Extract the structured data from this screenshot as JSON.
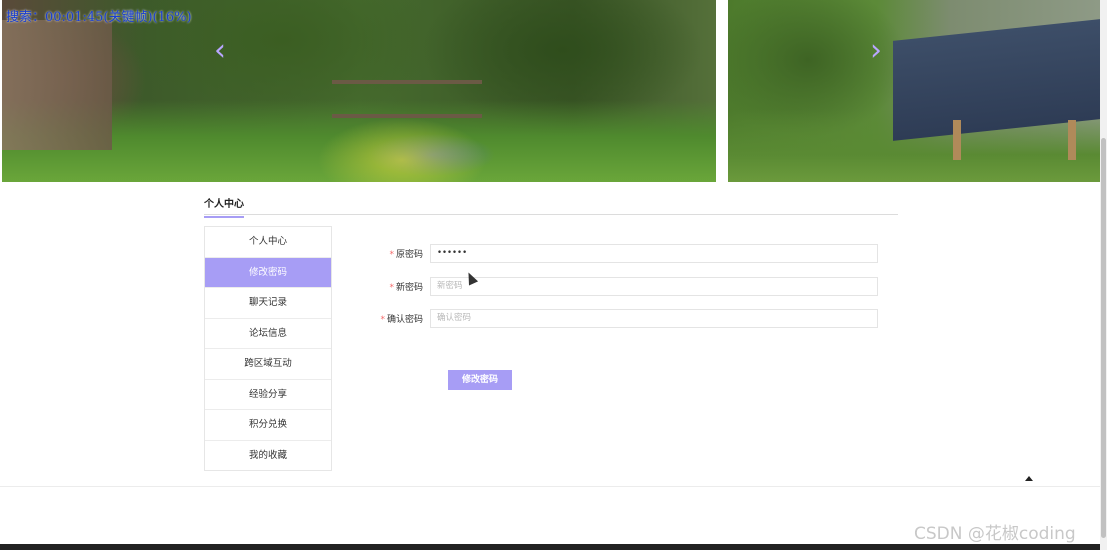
{
  "overlay": {
    "search_status": "搜索：00:01:45(关键帧)(16%)"
  },
  "banner": {
    "prev_arrow": "‹",
    "next_arrow": "›"
  },
  "section": {
    "title": "个人中心"
  },
  "menu": {
    "items": [
      {
        "label": "个人中心",
        "active": false
      },
      {
        "label": "修改密码",
        "active": true
      },
      {
        "label": "聊天记录",
        "active": false
      },
      {
        "label": "论坛信息",
        "active": false
      },
      {
        "label": "跨区域互动",
        "active": false
      },
      {
        "label": "经验分享",
        "active": false
      },
      {
        "label": "积分兑换",
        "active": false
      },
      {
        "label": "我的收藏",
        "active": false
      }
    ]
  },
  "form": {
    "required_mark": "*",
    "old_password": {
      "label": "原密码",
      "value": "••••••",
      "placeholder": ""
    },
    "new_password": {
      "label": "新密码",
      "value": "",
      "placeholder": "新密码"
    },
    "confirm_password": {
      "label": "确认密码",
      "value": "",
      "placeholder": "确认密码"
    },
    "submit_label": "修改密码"
  },
  "footer": {
    "watermark": "CSDN @花椒coding"
  },
  "colors": {
    "accent": "#a79df5",
    "required": "#f56c6c"
  }
}
